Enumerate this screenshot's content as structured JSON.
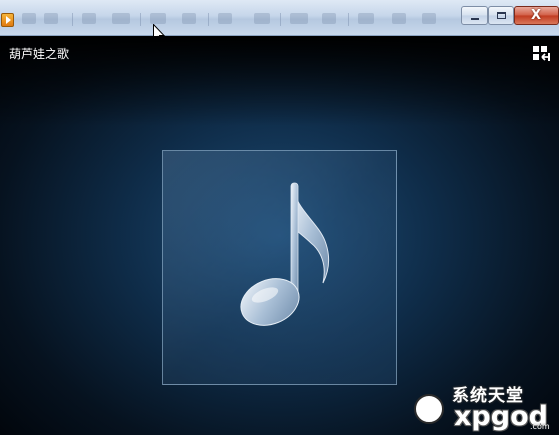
{
  "window": {
    "icons": {
      "app": "media-player-icon",
      "minimize": "minimize-icon",
      "maximize": "maximize-icon",
      "close": "close-icon"
    },
    "close_glyph": "X"
  },
  "now_playing": {
    "song_title": "葫芦娃之歌",
    "switch_mode_icon": "switch-to-library-icon",
    "album_art_icon": "music-note-icon"
  },
  "watermark": {
    "chinese": "系统天堂",
    "brand": "xpgod",
    "domain": ".com"
  },
  "colors": {
    "titlebar": "#c6d6ea",
    "player_bg": "#0f2d4a",
    "accent_glow": "#1f4e78",
    "close_button": "#c13a1f"
  }
}
